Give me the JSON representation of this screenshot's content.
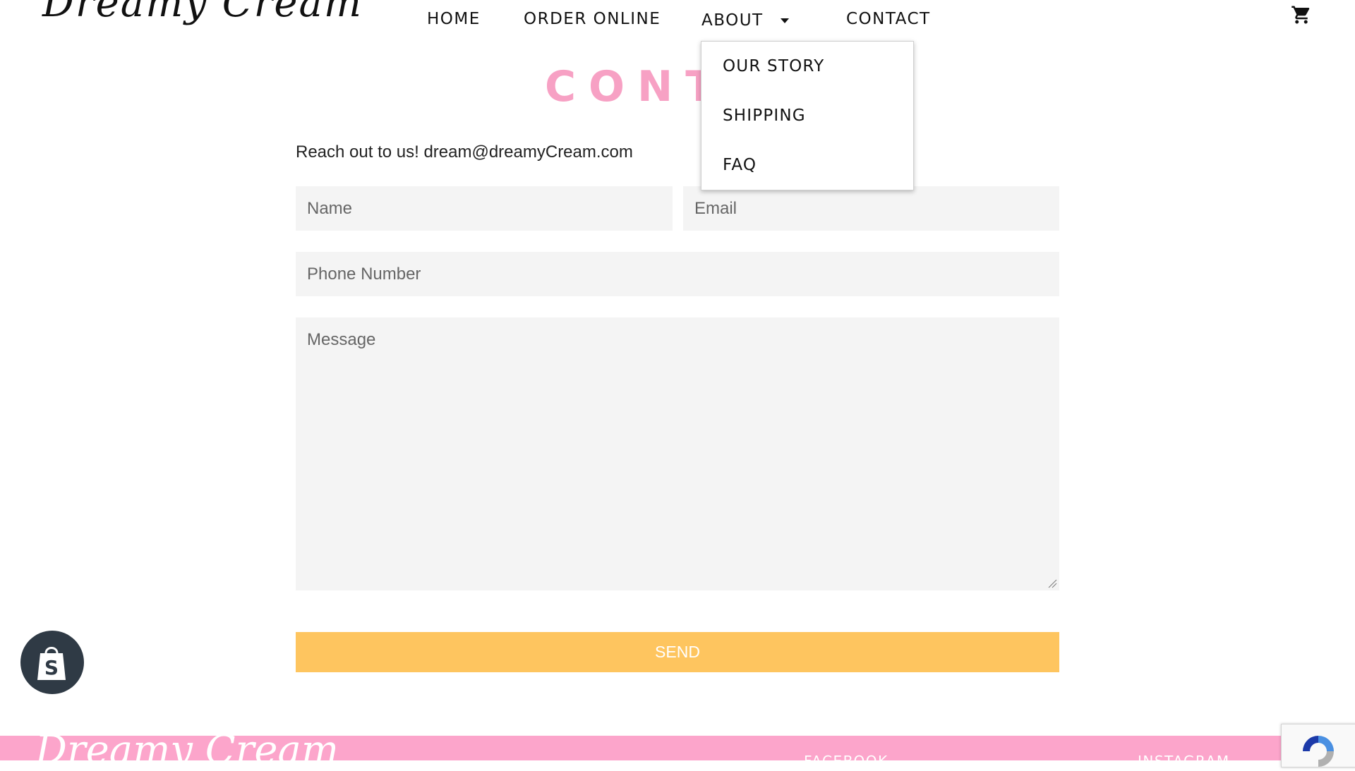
{
  "header": {
    "logo_text": "Dreamy Cream",
    "nav": {
      "home": "HOME",
      "order_online": "ORDER ONLINE",
      "about": "ABOUT",
      "contact": "CONTACT"
    },
    "cart_icon": "shopping-cart-icon"
  },
  "about_dropdown": {
    "items": [
      "OUR STORY",
      "SHIPPING",
      "FAQ"
    ]
  },
  "main": {
    "title": "CONT",
    "intro": "Reach out to us! dream@dreamyCream.com",
    "form": {
      "name_placeholder": "Name",
      "email_placeholder": "Email",
      "phone_placeholder": "Phone Number",
      "message_placeholder": "Message",
      "send_label": "SEND"
    }
  },
  "footer": {
    "logo_text": "Dreamy Cream",
    "links": [
      "FACEBOOK",
      "INSTAGRAM"
    ]
  },
  "colors": {
    "accent_pink": "#f7a1c4",
    "footer_pink": "#fca5cb",
    "send_yellow": "#fec55f",
    "field_bg": "#f4f4f4",
    "shopify_badge": "#2f3a45"
  }
}
